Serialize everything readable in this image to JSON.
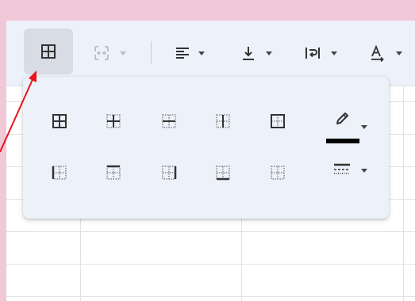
{
  "toolbar": {
    "buttons": [
      {
        "icon": "borders-icon",
        "state": "active"
      },
      {
        "icon": "merge-cells-icon",
        "state": "disabled"
      },
      {
        "icon": "horizontal-align-icon"
      },
      {
        "icon": "vertical-align-icon"
      },
      {
        "icon": "text-wrapping-icon"
      },
      {
        "icon": "text-rotation-icon"
      }
    ]
  },
  "borders_popup": {
    "row1": [
      "all-borders-icon",
      "inner-borders-icon",
      "horizontal-borders-icon",
      "vertical-borders-icon",
      "outer-borders-icon"
    ],
    "row2": [
      "left-border-icon",
      "top-border-icon",
      "right-border-icon",
      "bottom-border-icon",
      "clear-borders-icon"
    ],
    "border_color": "#000000",
    "tools": [
      "border-color-pencil-icon",
      "border-style-icon"
    ]
  },
  "annotation": {
    "arrow_color": "#e8141c"
  }
}
